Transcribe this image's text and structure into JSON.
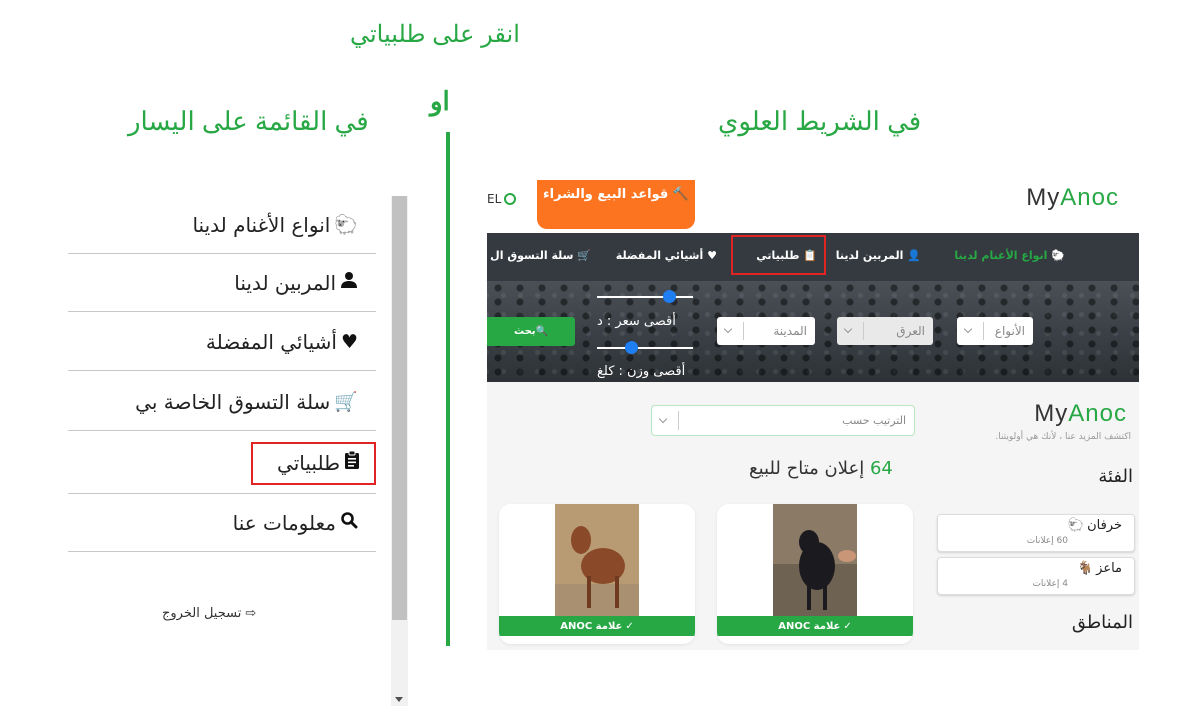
{
  "headings": {
    "click": "انقر على طلبياتي",
    "or": "او",
    "left_menu": "في القائمة على اليسار",
    "top_bar": "في الشريط العلوي"
  },
  "sidebar": {
    "items": [
      {
        "label": "انواع الأغنام لدينا",
        "icon": "sheep-icon"
      },
      {
        "label": "المربين لدينا",
        "icon": "user-icon"
      },
      {
        "label": "أشيائي المفضلة",
        "icon": "heart-icon"
      },
      {
        "label": "سلة التسوق الخاصة بي",
        "icon": "cart-icon"
      },
      {
        "label": "طلبياتي",
        "icon": "clipboard-icon",
        "highlighted": true
      },
      {
        "label": "معلومات عنا",
        "icon": "search-icon"
      }
    ],
    "logout": "تسجيل الخروج"
  },
  "site": {
    "logo_part1": "My",
    "logo_part2": "Anoc",
    "user_label": "EL",
    "rules_button": "قواعد البيع والشراء",
    "nav": {
      "sheep_types": "انواع الأغنام لدينا",
      "breeders": "المربين لدينا",
      "orders": "طلبياتي",
      "favorites": "أشيائي المفضلة",
      "cart": "سلة التسوق ال"
    },
    "filters": {
      "types": "الأنواع",
      "breed": "العرق",
      "city": "المدينة",
      "max_price": "أقصى سعر : د",
      "max_weight": "أقصى وزن : كلغ",
      "search": "بحث",
      "price_slider_value": 0.75,
      "weight_slider_value": 0.35
    },
    "sort_placeholder": "الترتيب حسب",
    "listing_count": "64",
    "listing_text": "إعلان متاح للبيع",
    "tagline": "اكتشف المزيد عنا ، لأنك هي أولويتنا.",
    "category_heading": "الفئة",
    "categories": [
      {
        "name": "خرفان",
        "count": "60 إعلانات"
      },
      {
        "name": "ماعز",
        "count": "4 إعلانات"
      }
    ],
    "regions_heading": "المناطق",
    "badge": "علامة ANOC"
  },
  "colors": {
    "green": "#27a844",
    "orange": "#fd7420",
    "nav_bg": "#343a40",
    "highlight_red": "#e02424"
  }
}
